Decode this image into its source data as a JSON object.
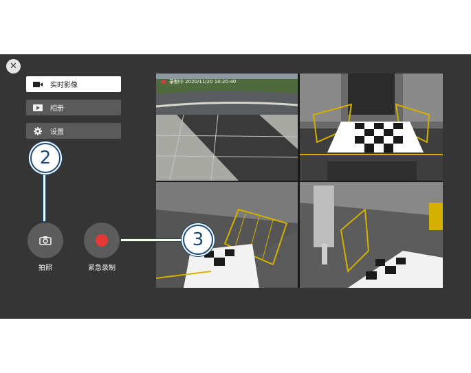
{
  "close": {
    "icon": "close-icon",
    "glyph": "✕"
  },
  "menu": {
    "items": [
      {
        "label": "实时影像",
        "icon": "video-camera-icon",
        "active": true
      },
      {
        "label": "相册",
        "icon": "play-album-icon",
        "active": false
      },
      {
        "label": "设置",
        "icon": "gear-icon",
        "active": false
      }
    ]
  },
  "buttons": {
    "photo": {
      "label": "拍照",
      "icon": "camera-icon"
    },
    "record": {
      "label": "紧急录制",
      "icon": "record-dot-icon"
    }
  },
  "camera": {
    "overlay": "录制中  2020/11/20   10:20:40"
  },
  "callouts": {
    "two": "2",
    "three": "3"
  },
  "colors": {
    "screen_bg": "#353535",
    "button_bg": "#5c5c5c",
    "record_red": "#e53935",
    "callout_blue": "#1b4a7a"
  }
}
